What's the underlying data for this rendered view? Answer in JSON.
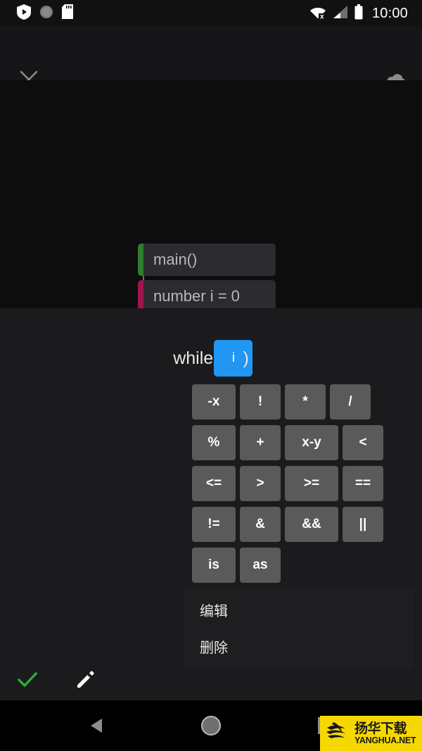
{
  "statusbar": {
    "icons": [
      "shield-play-icon",
      "circle-dotted-icon",
      "sd-card-icon"
    ],
    "wifi": "wifi-off-icon",
    "signal": "signal-bars-icon",
    "battery": "battery-full-icon",
    "clock": "10:00"
  },
  "appbar": {
    "close": "close-icon",
    "upload": "cloud-upload-icon"
  },
  "canvas": {
    "blocks": [
      {
        "text": "main()",
        "accent": "#2f7d32"
      },
      {
        "text": "number i = 0",
        "accent": "#a0154c"
      }
    ]
  },
  "sheet": {
    "expression": {
      "prefix": "while (",
      "selected_token": "i",
      "suffix": ")",
      "selection_color": "#2196F3"
    },
    "keypad": [
      [
        "-x",
        "!",
        "*",
        "/"
      ],
      [
        "%",
        "+",
        "x-y",
        "<"
      ],
      [
        "<=",
        ">",
        ">=",
        "=="
      ],
      [
        "!=",
        "&",
        "&&",
        "||"
      ],
      [
        "is",
        "as"
      ]
    ],
    "menu": [
      {
        "label": "编辑"
      },
      {
        "label": "删除"
      }
    ],
    "actions": [
      {
        "name": "confirm",
        "icon": "check-icon",
        "color": "#2eaa3c"
      },
      {
        "name": "edit",
        "icon": "pencil-icon",
        "color": "#ffffff"
      }
    ]
  },
  "navbar": {
    "back": "back-triangle-icon",
    "home": "home-circle-icon",
    "recents": "recents-square-icon"
  },
  "watermark": {
    "cn": "扬华下载",
    "en": "YANGHUA.NET",
    "bg": "#F5D800"
  }
}
